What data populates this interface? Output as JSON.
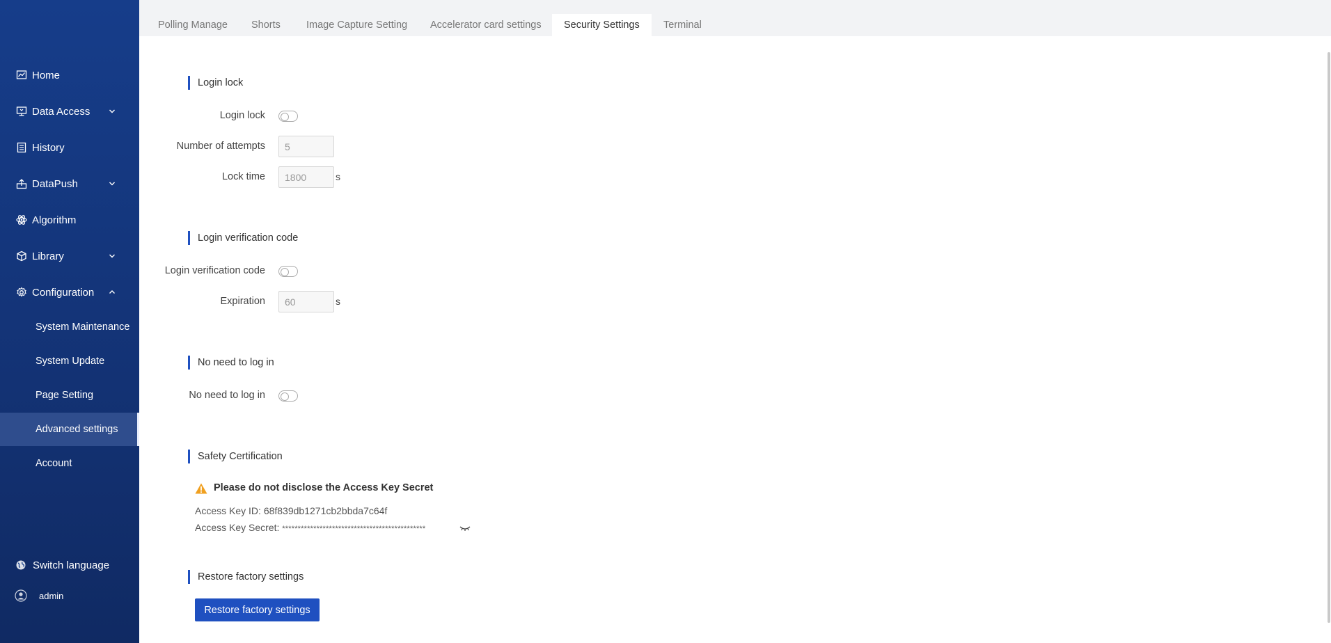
{
  "sidebar": {
    "nav": [
      {
        "label": "Home",
        "icon": "chart-line-icon"
      },
      {
        "label": "Data Access",
        "icon": "monitor-icon"
      },
      {
        "label": "History",
        "icon": "document-icon"
      },
      {
        "label": "DataPush",
        "icon": "upload-icon"
      },
      {
        "label": "Algorithm",
        "icon": "atom-icon"
      },
      {
        "label": "Library",
        "icon": "cube-icon"
      },
      {
        "label": "Configuration",
        "icon": "gear-icon"
      }
    ],
    "sub": [
      {
        "label": "System Maintenance"
      },
      {
        "label": "System Update"
      },
      {
        "label": "Page Setting"
      },
      {
        "label": "Advanced settings"
      },
      {
        "label": "Account"
      }
    ],
    "switch_language": "Switch language",
    "user": "admin"
  },
  "tabs": [
    {
      "label": "Polling Manage"
    },
    {
      "label": "Shorts"
    },
    {
      "label": "Image Capture Setting"
    },
    {
      "label": "Accelerator card settings"
    },
    {
      "label": "Security Settings"
    },
    {
      "label": "Terminal"
    }
  ],
  "login_lock": {
    "title": "Login lock",
    "toggle_label": "Login lock",
    "attempts_label": "Number of attempts",
    "attempts_value": "5",
    "lock_time_label": "Lock time",
    "lock_time_value": "1800",
    "unit": "s"
  },
  "verification": {
    "title": "Login verification code",
    "toggle_label": "Login verification code",
    "expiration_label": "Expiration",
    "expiration_value": "60",
    "unit": "s"
  },
  "no_login": {
    "title": "No need to log in",
    "toggle_label": "No need to log in"
  },
  "safety": {
    "title": "Safety Certification",
    "warning": "Please do not disclose the Access Key Secret",
    "key_id_label": "Access Key ID: ",
    "key_id": "68f839db1271cb2bbda7c64f",
    "key_secret_label": "Access Key Secret: ",
    "key_secret": "**********************************************"
  },
  "restore": {
    "title": "Restore factory settings",
    "button": "Restore factory settings"
  },
  "colors": {
    "accent": "#1f50c0",
    "sidebar": "#163d8a",
    "warning": "#f0a020"
  }
}
